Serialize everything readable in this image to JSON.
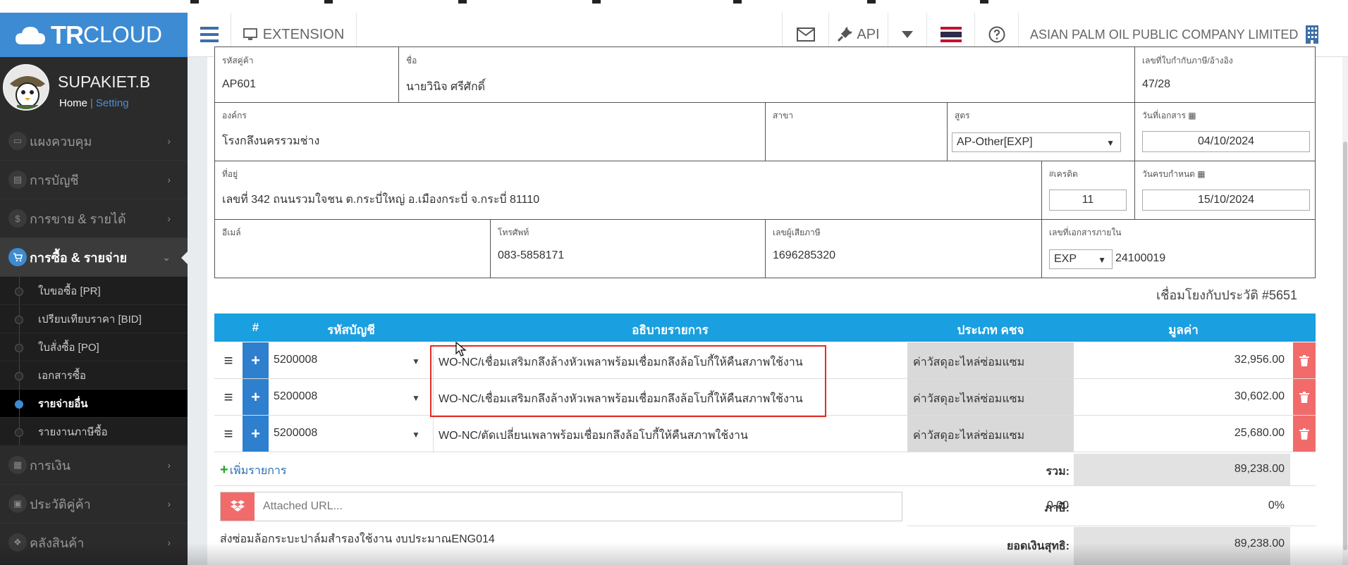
{
  "brand": {
    "tr": "TR",
    "cloud": "CLOUD"
  },
  "topbar": {
    "extension_label": "EXTENSION",
    "api_label": "API",
    "company_name": "ASIAN PALM OIL PUBLIC COMPANY LIMITED"
  },
  "user": {
    "name": "SUPAKIET.B",
    "home": "Home",
    "sep": "|",
    "setting": "Setting"
  },
  "sidebar": {
    "items": [
      {
        "label": "แผงควบคุม",
        "icon": "monitor-icon"
      },
      {
        "label": "การบัญชี",
        "icon": "book-icon"
      },
      {
        "label": "การขาย & รายได้",
        "icon": "dollar-icon"
      },
      {
        "label": "การซื้อ & รายจ่าย",
        "icon": "cart-icon",
        "active": true
      },
      {
        "label": "การเงิน",
        "icon": "calendar-icon"
      },
      {
        "label": "ประวัติคู่ค้า",
        "icon": "contact-icon"
      },
      {
        "label": "คลังสินค้า",
        "icon": "cubes-icon"
      }
    ],
    "sub_items": [
      {
        "label": "ใบขอซื้อ [PR]"
      },
      {
        "label": "เปรียบเทียบราคา [BID]"
      },
      {
        "label": "ใบสั่งซื้อ [PO]"
      },
      {
        "label": "เอกสารซื้อ"
      },
      {
        "label": "รายจ่ายอื่น",
        "active": true
      },
      {
        "label": "รายงานภาษีซื้อ"
      }
    ]
  },
  "form": {
    "row1": {
      "vendor_code_label": "รหัสคู่ค้า",
      "vendor_code": "AP601",
      "name_label": "ชื่อ",
      "name": "นายวินิจ ศรีศักดิ์",
      "tax_invoice_label": "เลขที่ใบกำกับภาษี/อ้างอิง",
      "tax_invoice": "47/28"
    },
    "row2": {
      "org_label": "องค์กร",
      "org": "โรงกลึงนครรวมช่าง",
      "branch_label": "สาขา",
      "branch": "",
      "formula_label": "สูตร",
      "formula": "AP-Other[EXP]",
      "doc_date_label": "วันที่เอกสาร",
      "doc_date": "04/10/2024"
    },
    "row3": {
      "address_label": "ที่อยู่",
      "address": "เลขที่ 342 ถนนรวมใจชน ต.กระบี่ใหญ่ อ.เมืองกระบี่ จ.กระบี่ 81110",
      "credit_label": "#เครดิต",
      "credit": "11",
      "due_label": "วันครบกำหนด",
      "due_date": "15/10/2024"
    },
    "row4": {
      "email_label": "อีเมล์",
      "email": "",
      "phone_label": "โทรศัพท์",
      "phone": "083-5858171",
      "taxid_label": "เลขผู้เสียภาษี",
      "taxid": "1696285320",
      "internal_label": "เลขที่เอกสารภายใน",
      "internal_prefix": "EXP",
      "internal_no": "24100019"
    }
  },
  "history_link": "เชื่อมโยงกับประวัติ #5651",
  "table": {
    "headers": {
      "num": "#",
      "account": "รหัสบัญชี",
      "desc": "อธิบายรายการ",
      "type": "ประเภท คชจ",
      "value": "มูลค่า"
    },
    "rows": [
      {
        "account": "5200008",
        "desc": "WO-NC/เชื่อมเสริมกลึงล้างหัวเพลาพร้อมเชื่อมกลึงล้อโบกี้ให้คืนสภาพใช้งาน",
        "type": "ค่าวัสดุอะไหล่ซ่อมแซม",
        "value": "32,956.00"
      },
      {
        "account": "5200008",
        "desc": "WO-NC/เชื่อมเสริมกลึงล้างหัวเพลาพร้อมเชื่อมกลึงล้อโบกี้ให้คืนสภาพใช้งาน",
        "type": "ค่าวัสดุอะไหล่ซ่อมแซม",
        "value": "30,602.00"
      },
      {
        "account": "5200008",
        "desc": "WO-NC/ตัดเปลี่ยนเพลาพร้อมเชื่อมกลึงล้อโบกี้ให้คืนสภาพใช้งาน",
        "type": "ค่าวัสดุอะไหล่ซ่อมแซม",
        "value": "25,680.00"
      }
    ],
    "add_line": "เพิ่มรายการ",
    "total_label": "รวม:",
    "total": "89,238.00",
    "tax_label": "ภาษี:",
    "tax_value": "0.00",
    "tax_pct": "0%",
    "net_label": "ยอดเงินสุทธิ:",
    "net": "89,238.00"
  },
  "attached_url_placeholder": "Attached URL...",
  "note": "ส่งซ่อมล้อกระบะปาล์มสำรองใช้งาน งบประมาณENG014",
  "colors": {
    "brand_blue": "#3d8bd3",
    "table_header": "#1a9fe0",
    "delete_red": "#f26b6b",
    "highlight_red": "#e12b2b"
  }
}
